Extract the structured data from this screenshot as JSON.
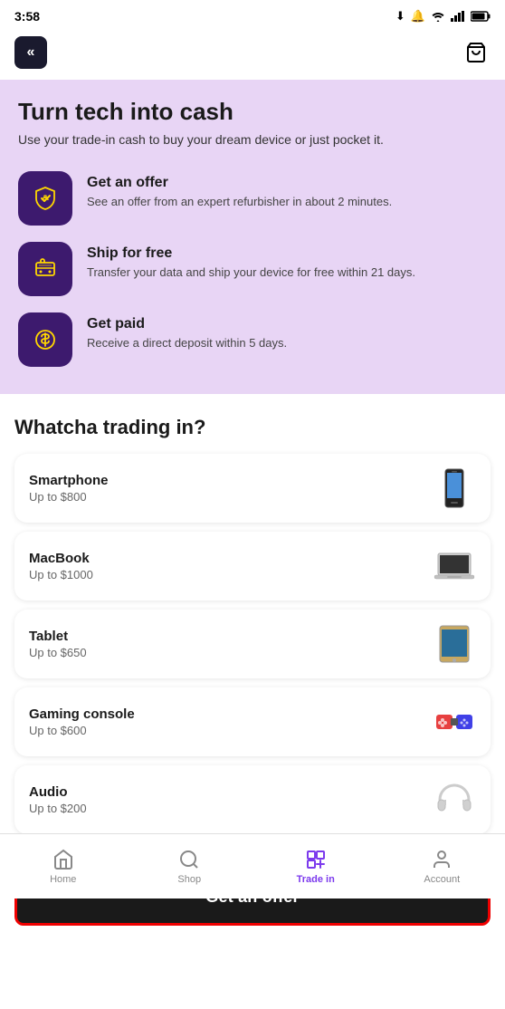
{
  "statusBar": {
    "time": "3:58",
    "icons": [
      "download-icon",
      "notification-icon",
      "wifi-icon",
      "signal-icon",
      "battery-icon"
    ]
  },
  "topNav": {
    "backLabel": "<<",
    "cartLabel": "cart"
  },
  "hero": {
    "title": "Turn tech into cash",
    "subtitle": "Use your trade-in cash to buy your dream device or just pocket it.",
    "features": [
      {
        "id": "get-offer",
        "title": "Get an offer",
        "desc": "See an offer from an expert refurbisher in about 2 minutes."
      },
      {
        "id": "ship-free",
        "title": "Ship for free",
        "desc": "Transfer your data and ship your device for free within 21 days."
      },
      {
        "id": "get-paid",
        "title": "Get paid",
        "desc": "Receive a direct deposit within 5 days."
      }
    ]
  },
  "tradingSection": {
    "title": "Whatcha trading in?",
    "items": [
      {
        "name": "Smartphone",
        "price": "Up to $800",
        "device": "smartphone"
      },
      {
        "name": "MacBook",
        "price": "Up to $1000",
        "device": "macbook"
      },
      {
        "name": "Tablet",
        "price": "Up to $650",
        "device": "tablet"
      },
      {
        "name": "Gaming console",
        "price": "Up to $600",
        "device": "gaming"
      },
      {
        "name": "Audio",
        "price": "Up to $200",
        "device": "audio"
      }
    ]
  },
  "cta": {
    "label": "Get an offer"
  },
  "bottomNav": {
    "items": [
      {
        "id": "home",
        "label": "Home",
        "active": false
      },
      {
        "id": "shop",
        "label": "Shop",
        "active": false
      },
      {
        "id": "trade-in",
        "label": "Trade in",
        "active": true
      },
      {
        "id": "account",
        "label": "Account",
        "active": false
      }
    ]
  }
}
